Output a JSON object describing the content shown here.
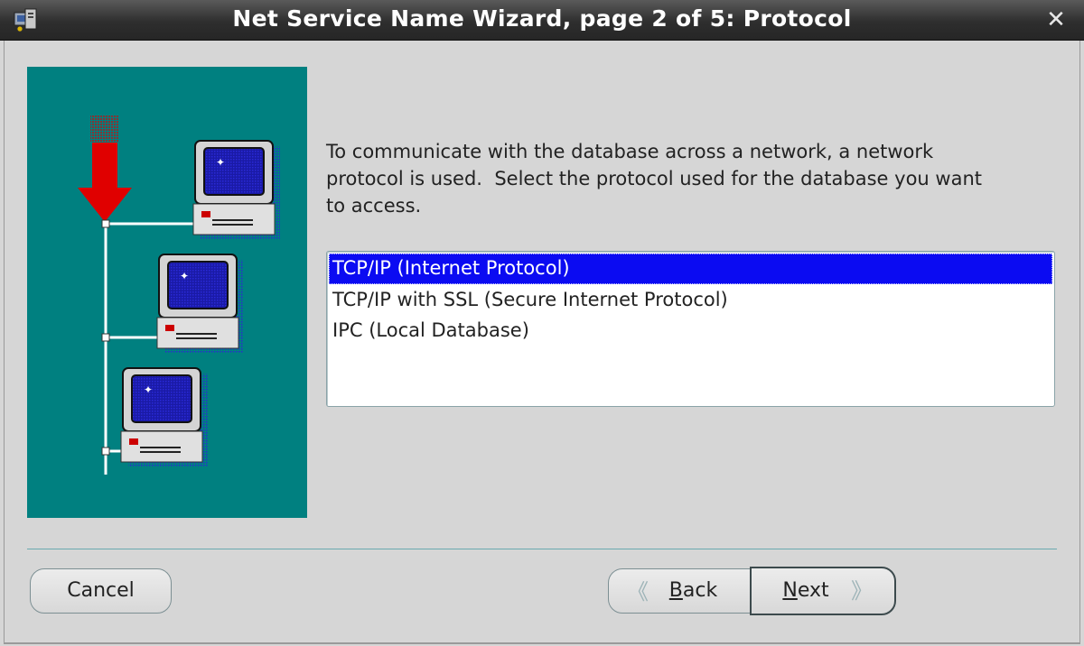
{
  "window": {
    "title": "Net Service Name Wizard, page 2 of 5: Protocol",
    "close_icon": "close-icon",
    "app_icon": "oracle-net-config-icon"
  },
  "content": {
    "instruction": "To communicate with the database across a network, a network\nprotocol is used.  Select the protocol used for the database you want\nto access.",
    "protocols": [
      {
        "label": "TCP/IP (Internet Protocol)",
        "selected": true
      },
      {
        "label": "TCP/IP with SSL (Secure Internet Protocol)",
        "selected": false
      },
      {
        "label": "IPC (Local Database)",
        "selected": false
      }
    ],
    "illustration": "network-computers-illustration"
  },
  "buttons": {
    "cancel_label": "Cancel",
    "back_label_mnemonic": "B",
    "back_label_rest": "ack",
    "next_label_mnemonic": "N",
    "next_label_rest": "ext"
  },
  "colors": {
    "illustration_bg": "#008080",
    "selection_bg": "#0b0bf2",
    "arrow": "#e00000"
  }
}
